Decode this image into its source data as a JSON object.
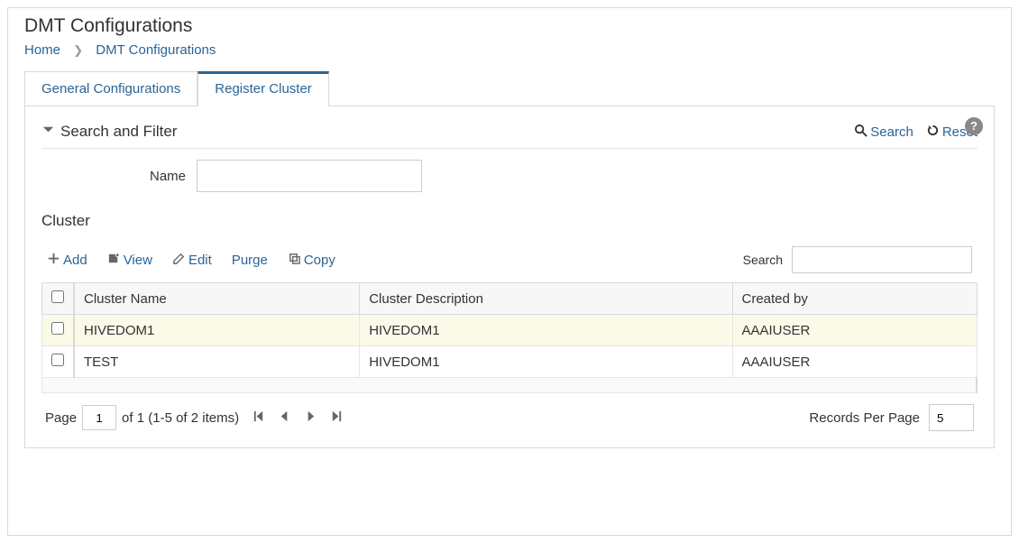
{
  "page_title": "DMT Configurations",
  "breadcrumb": {
    "home": "Home",
    "current": "DMT Configurations"
  },
  "tabs": {
    "general": "General Configurations",
    "register": "Register Cluster"
  },
  "search_filter": {
    "title": "Search and Filter",
    "search_btn": "Search",
    "reset_btn": "Reset",
    "name_label": "Name"
  },
  "cluster": {
    "heading": "Cluster",
    "add": "Add",
    "view": "View",
    "edit": "Edit",
    "purge": "Purge",
    "copy": "Copy",
    "search_label": "Search",
    "columns": {
      "name": "Cluster Name",
      "desc": "Cluster Description",
      "created": "Created by"
    },
    "rows": [
      {
        "name": "HIVEDOM1",
        "desc": "HIVEDOM1",
        "created": "AAAIUSER"
      },
      {
        "name": "TEST",
        "desc": "HIVEDOM1",
        "created": "AAAIUSER"
      }
    ]
  },
  "pager": {
    "page_label": "Page",
    "page_value": "1",
    "summary": "of 1 (1-5 of 2 items)",
    "rpp_label": "Records Per Page",
    "rpp_value": "5"
  }
}
